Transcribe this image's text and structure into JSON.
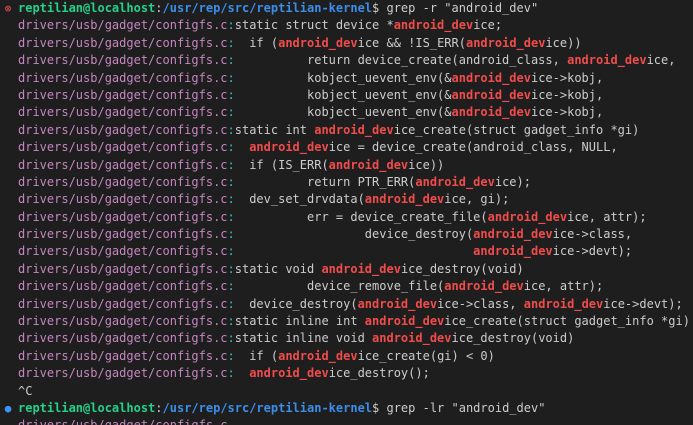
{
  "colors": {
    "background": "#1e1e1e",
    "text": "#cccccc",
    "user_host": "#23d18b",
    "cwd": "#3b8eea",
    "filename": "#c586c0",
    "separator": "#3bb8c8",
    "match": "#f14c4c",
    "marker_error": "#f14c4c",
    "marker_info": "#3794ff"
  },
  "icons": {
    "error_marker": "circle-x-icon",
    "info_marker": "circle-dot-icon"
  },
  "terminal": {
    "lines": [
      {
        "marker": "error",
        "segments": [
          {
            "t": "reptilian@localhost",
            "c": "user"
          },
          {
            "t": ":",
            "c": "plain"
          },
          {
            "t": "/usr/rep/src/reptilian-kernel",
            "c": "path"
          },
          {
            "t": "$ grep -r \"android_dev\"",
            "c": "plain"
          }
        ]
      },
      {
        "segments": [
          {
            "t": "drivers/usb/gadget/configfs.c",
            "c": "fn"
          },
          {
            "t": ":",
            "c": "sep"
          },
          {
            "t": "static struct device *",
            "c": "plain"
          },
          {
            "t": "android_dev",
            "c": "match"
          },
          {
            "t": "ice;",
            "c": "plain"
          }
        ]
      },
      {
        "segments": [
          {
            "t": "drivers/usb/gadget/configfs.c",
            "c": "fn"
          },
          {
            "t": ":",
            "c": "sep"
          },
          {
            "t": "  if (",
            "c": "plain"
          },
          {
            "t": "android_dev",
            "c": "match"
          },
          {
            "t": "ice && !IS_ERR(",
            "c": "plain"
          },
          {
            "t": "android_dev",
            "c": "match"
          },
          {
            "t": "ice))",
            "c": "plain"
          }
        ]
      },
      {
        "segments": [
          {
            "t": "drivers/usb/gadget/configfs.c",
            "c": "fn"
          },
          {
            "t": ":",
            "c": "sep"
          },
          {
            "t": "          return device_create(android_class, ",
            "c": "plain"
          },
          {
            "t": "android_dev",
            "c": "match"
          },
          {
            "t": "ice,",
            "c": "plain"
          }
        ]
      },
      {
        "segments": [
          {
            "t": "drivers/usb/gadget/configfs.c",
            "c": "fn"
          },
          {
            "t": ":",
            "c": "sep"
          },
          {
            "t": "          kobject_uevent_env(&",
            "c": "plain"
          },
          {
            "t": "android_dev",
            "c": "match"
          },
          {
            "t": "ice->kobj,",
            "c": "plain"
          }
        ]
      },
      {
        "segments": [
          {
            "t": "drivers/usb/gadget/configfs.c",
            "c": "fn"
          },
          {
            "t": ":",
            "c": "sep"
          },
          {
            "t": "          kobject_uevent_env(&",
            "c": "plain"
          },
          {
            "t": "android_dev",
            "c": "match"
          },
          {
            "t": "ice->kobj,",
            "c": "plain"
          }
        ]
      },
      {
        "segments": [
          {
            "t": "drivers/usb/gadget/configfs.c",
            "c": "fn"
          },
          {
            "t": ":",
            "c": "sep"
          },
          {
            "t": "          kobject_uevent_env(&",
            "c": "plain"
          },
          {
            "t": "android_dev",
            "c": "match"
          },
          {
            "t": "ice->kobj,",
            "c": "plain"
          }
        ]
      },
      {
        "segments": [
          {
            "t": "drivers/usb/gadget/configfs.c",
            "c": "fn"
          },
          {
            "t": ":",
            "c": "sep"
          },
          {
            "t": "static int ",
            "c": "plain"
          },
          {
            "t": "android_dev",
            "c": "match"
          },
          {
            "t": "ice_create(struct gadget_info *gi)",
            "c": "plain"
          }
        ]
      },
      {
        "segments": [
          {
            "t": "drivers/usb/gadget/configfs.c",
            "c": "fn"
          },
          {
            "t": ":",
            "c": "sep"
          },
          {
            "t": "  ",
            "c": "plain"
          },
          {
            "t": "android_dev",
            "c": "match"
          },
          {
            "t": "ice = device_create(android_class, NULL,",
            "c": "plain"
          }
        ]
      },
      {
        "segments": [
          {
            "t": "drivers/usb/gadget/configfs.c",
            "c": "fn"
          },
          {
            "t": ":",
            "c": "sep"
          },
          {
            "t": "  if (IS_ERR(",
            "c": "plain"
          },
          {
            "t": "android_dev",
            "c": "match"
          },
          {
            "t": "ice))",
            "c": "plain"
          }
        ]
      },
      {
        "segments": [
          {
            "t": "drivers/usb/gadget/configfs.c",
            "c": "fn"
          },
          {
            "t": ":",
            "c": "sep"
          },
          {
            "t": "          return PTR_ERR(",
            "c": "plain"
          },
          {
            "t": "android_dev",
            "c": "match"
          },
          {
            "t": "ice);",
            "c": "plain"
          }
        ]
      },
      {
        "segments": [
          {
            "t": "drivers/usb/gadget/configfs.c",
            "c": "fn"
          },
          {
            "t": ":",
            "c": "sep"
          },
          {
            "t": "  dev_set_drvdata(",
            "c": "plain"
          },
          {
            "t": "android_dev",
            "c": "match"
          },
          {
            "t": "ice, gi);",
            "c": "plain"
          }
        ]
      },
      {
        "segments": [
          {
            "t": "drivers/usb/gadget/configfs.c",
            "c": "fn"
          },
          {
            "t": ":",
            "c": "sep"
          },
          {
            "t": "          err = device_create_file(",
            "c": "plain"
          },
          {
            "t": "android_dev",
            "c": "match"
          },
          {
            "t": "ice, attr);",
            "c": "plain"
          }
        ]
      },
      {
        "segments": [
          {
            "t": "drivers/usb/gadget/configfs.c",
            "c": "fn"
          },
          {
            "t": ":",
            "c": "sep"
          },
          {
            "t": "                  device_destroy(",
            "c": "plain"
          },
          {
            "t": "android_dev",
            "c": "match"
          },
          {
            "t": "ice->class,",
            "c": "plain"
          }
        ]
      },
      {
        "segments": [
          {
            "t": "drivers/usb/gadget/configfs.c",
            "c": "fn"
          },
          {
            "t": ":",
            "c": "sep"
          },
          {
            "t": "                                 ",
            "c": "plain"
          },
          {
            "t": "android_dev",
            "c": "match"
          },
          {
            "t": "ice->devt);",
            "c": "plain"
          }
        ]
      },
      {
        "segments": [
          {
            "t": "drivers/usb/gadget/configfs.c",
            "c": "fn"
          },
          {
            "t": ":",
            "c": "sep"
          },
          {
            "t": "static void ",
            "c": "plain"
          },
          {
            "t": "android_dev",
            "c": "match"
          },
          {
            "t": "ice_destroy(void)",
            "c": "plain"
          }
        ]
      },
      {
        "segments": [
          {
            "t": "drivers/usb/gadget/configfs.c",
            "c": "fn"
          },
          {
            "t": ":",
            "c": "sep"
          },
          {
            "t": "          device_remove_file(",
            "c": "plain"
          },
          {
            "t": "android_dev",
            "c": "match"
          },
          {
            "t": "ice, attr);",
            "c": "plain"
          }
        ]
      },
      {
        "segments": [
          {
            "t": "drivers/usb/gadget/configfs.c",
            "c": "fn"
          },
          {
            "t": ":",
            "c": "sep"
          },
          {
            "t": "  device_destroy(",
            "c": "plain"
          },
          {
            "t": "android_dev",
            "c": "match"
          },
          {
            "t": "ice->class, ",
            "c": "plain"
          },
          {
            "t": "android_dev",
            "c": "match"
          },
          {
            "t": "ice->devt);",
            "c": "plain"
          }
        ]
      },
      {
        "segments": [
          {
            "t": "drivers/usb/gadget/configfs.c",
            "c": "fn"
          },
          {
            "t": ":",
            "c": "sep"
          },
          {
            "t": "static inline int ",
            "c": "plain"
          },
          {
            "t": "android_dev",
            "c": "match"
          },
          {
            "t": "ice_create(struct gadget_info *gi)",
            "c": "plain"
          }
        ]
      },
      {
        "segments": [
          {
            "t": "drivers/usb/gadget/configfs.c",
            "c": "fn"
          },
          {
            "t": ":",
            "c": "sep"
          },
          {
            "t": "static inline void ",
            "c": "plain"
          },
          {
            "t": "android_dev",
            "c": "match"
          },
          {
            "t": "ice_destroy(void)",
            "c": "plain"
          }
        ]
      },
      {
        "segments": [
          {
            "t": "drivers/usb/gadget/configfs.c",
            "c": "fn"
          },
          {
            "t": ":",
            "c": "sep"
          },
          {
            "t": "  if (",
            "c": "plain"
          },
          {
            "t": "android_dev",
            "c": "match"
          },
          {
            "t": "ice_create(gi) < 0)",
            "c": "plain"
          }
        ]
      },
      {
        "segments": [
          {
            "t": "drivers/usb/gadget/configfs.c",
            "c": "fn"
          },
          {
            "t": ":",
            "c": "sep"
          },
          {
            "t": "  ",
            "c": "plain"
          },
          {
            "t": "android_dev",
            "c": "match"
          },
          {
            "t": "ice_destroy();",
            "c": "plain"
          }
        ]
      },
      {
        "segments": [
          {
            "t": "^C",
            "c": "plain"
          }
        ]
      },
      {
        "marker": "info",
        "segments": [
          {
            "t": "reptilian@localhost",
            "c": "user"
          },
          {
            "t": ":",
            "c": "plain"
          },
          {
            "t": "/usr/rep/src/reptilian-kernel",
            "c": "path"
          },
          {
            "t": "$ grep -lr \"android_dev\"",
            "c": "plain"
          }
        ]
      },
      {
        "segments": [
          {
            "t": "drivers/usb/gadget/configfs.c",
            "c": "fn"
          }
        ]
      }
    ]
  }
}
